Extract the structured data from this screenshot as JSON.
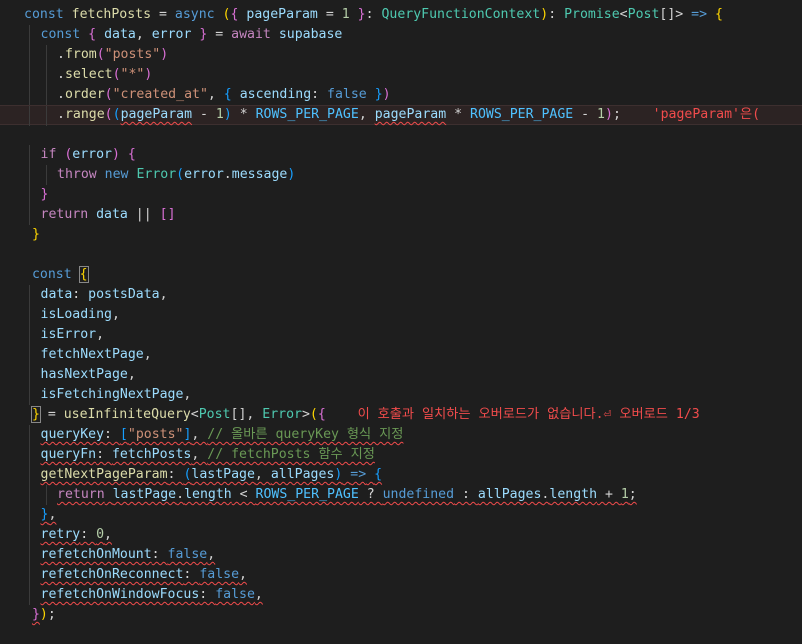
{
  "editor": {
    "lines": [
      {
        "indent": 0,
        "tokens": [
          [
            "kw",
            "const"
          ],
          [
            "op",
            " "
          ],
          [
            "fn",
            "fetchPosts"
          ],
          [
            "op",
            " = "
          ],
          [
            "kw",
            "async"
          ],
          [
            "op",
            " "
          ],
          [
            "br1",
            "("
          ],
          [
            "br2",
            "{"
          ],
          [
            "op",
            " "
          ],
          [
            "var",
            "pageParam"
          ],
          [
            "op",
            " = "
          ],
          [
            "num",
            "1"
          ],
          [
            "op",
            " "
          ],
          [
            "br2",
            "}"
          ],
          [
            "op",
            ": "
          ],
          [
            "type",
            "QueryFunctionContext"
          ],
          [
            "br1",
            ")"
          ],
          [
            "op",
            ": "
          ],
          [
            "type",
            "Promise"
          ],
          [
            "op",
            "<"
          ],
          [
            "type",
            "Post"
          ],
          [
            "op",
            "[]> "
          ],
          [
            "kw",
            "=>"
          ],
          [
            "op",
            " "
          ],
          [
            "br1",
            "{"
          ]
        ]
      },
      {
        "indent": 1,
        "tokens": [
          [
            "kw",
            "const"
          ],
          [
            "op",
            " "
          ],
          [
            "br2",
            "{"
          ],
          [
            "op",
            " "
          ],
          [
            "var",
            "data"
          ],
          [
            "op",
            ", "
          ],
          [
            "var",
            "error"
          ],
          [
            "op",
            " "
          ],
          [
            "br2",
            "}"
          ],
          [
            "op",
            " = "
          ],
          [
            "ctrl",
            "await"
          ],
          [
            "op",
            " "
          ],
          [
            "var",
            "supabase"
          ]
        ]
      },
      {
        "indent": 2,
        "tokens": [
          [
            "op",
            "."
          ],
          [
            "fn",
            "from"
          ],
          [
            "br2",
            "("
          ],
          [
            "str",
            "\"posts\""
          ],
          [
            "br2",
            ")"
          ]
        ]
      },
      {
        "indent": 2,
        "tokens": [
          [
            "op",
            "."
          ],
          [
            "fn",
            "select"
          ],
          [
            "br2",
            "("
          ],
          [
            "str",
            "\"*\""
          ],
          [
            "br2",
            ")"
          ]
        ]
      },
      {
        "indent": 2,
        "tokens": [
          [
            "op",
            "."
          ],
          [
            "fn",
            "order"
          ],
          [
            "br2",
            "("
          ],
          [
            "str",
            "\"created_at\""
          ],
          [
            "op",
            ", "
          ],
          [
            "br3",
            "{"
          ],
          [
            "op",
            " "
          ],
          [
            "var",
            "ascending"
          ],
          [
            "op",
            ": "
          ],
          [
            "kw",
            "false"
          ],
          [
            "op",
            " "
          ],
          [
            "br3",
            "}"
          ],
          [
            "br2",
            ")"
          ]
        ]
      },
      {
        "indent": 2,
        "hl": true,
        "tokens": [
          [
            "op",
            "."
          ],
          [
            "fn",
            "range"
          ],
          [
            "br2",
            "("
          ],
          [
            "br3",
            "("
          ],
          [
            "wvar",
            "pageParam"
          ],
          [
            "op",
            " - "
          ],
          [
            "num",
            "1"
          ],
          [
            "br3",
            ")"
          ],
          [
            "op",
            " * "
          ],
          [
            "const",
            "ROWS_PER_PAGE"
          ],
          [
            "op",
            ", "
          ],
          [
            "wvar",
            "pageParam"
          ],
          [
            "op",
            " * "
          ],
          [
            "const",
            "ROWS_PER_PAGE"
          ],
          [
            "op",
            " - "
          ],
          [
            "num",
            "1"
          ],
          [
            "br2",
            ")"
          ],
          [
            "op",
            ";"
          ],
          [
            "err",
            "    'pageParam'은("
          ]
        ]
      },
      {
        "indent": 0,
        "tokens": []
      },
      {
        "indent": 1,
        "tokens": [
          [
            "ctrl",
            "if"
          ],
          [
            "op",
            " "
          ],
          [
            "br2",
            "("
          ],
          [
            "var",
            "error"
          ],
          [
            "br2",
            ")"
          ],
          [
            "op",
            " "
          ],
          [
            "br2",
            "{"
          ]
        ]
      },
      {
        "indent": 2,
        "tokens": [
          [
            "ctrl",
            "throw"
          ],
          [
            "op",
            " "
          ],
          [
            "kw",
            "new"
          ],
          [
            "op",
            " "
          ],
          [
            "type",
            "Error"
          ],
          [
            "br3",
            "("
          ],
          [
            "var",
            "error"
          ],
          [
            "op",
            "."
          ],
          [
            "var",
            "message"
          ],
          [
            "br3",
            ")"
          ]
        ]
      },
      {
        "indent": 1,
        "tokens": [
          [
            "br2",
            "}"
          ]
        ]
      },
      {
        "indent": 1,
        "tokens": [
          [
            "ctrl",
            "return"
          ],
          [
            "op",
            " "
          ],
          [
            "var",
            "data"
          ],
          [
            "op",
            " || "
          ],
          [
            "br2",
            "[]"
          ]
        ]
      },
      {
        "indent": 0,
        "tokens": [
          [
            "op",
            " "
          ],
          [
            "br1",
            "}"
          ]
        ]
      },
      {
        "indent": 0,
        "tokens": []
      },
      {
        "indent": 0,
        "tokens": [
          [
            "op",
            " "
          ],
          [
            "kw",
            "const"
          ],
          [
            "op",
            " "
          ],
          [
            "curbr",
            "{"
          ]
        ]
      },
      {
        "indent": 1,
        "tokens": [
          [
            "var",
            "data"
          ],
          [
            "op",
            ": "
          ],
          [
            "var",
            "postsData"
          ],
          [
            "op",
            ","
          ]
        ]
      },
      {
        "indent": 1,
        "tokens": [
          [
            "var",
            "isLoading"
          ],
          [
            "op",
            ","
          ]
        ]
      },
      {
        "indent": 1,
        "tokens": [
          [
            "var",
            "isError"
          ],
          [
            "op",
            ","
          ]
        ]
      },
      {
        "indent": 1,
        "tokens": [
          [
            "var",
            "fetchNextPage"
          ],
          [
            "op",
            ","
          ]
        ]
      },
      {
        "indent": 1,
        "tokens": [
          [
            "var",
            "hasNextPage"
          ],
          [
            "op",
            ","
          ]
        ]
      },
      {
        "indent": 1,
        "tokens": [
          [
            "var",
            "isFetchingNextPage"
          ],
          [
            "op",
            ","
          ]
        ]
      },
      {
        "indent": 0,
        "tokens": [
          [
            "op",
            " "
          ],
          [
            "curbr",
            "}"
          ],
          [
            "op",
            " = "
          ],
          [
            "fn",
            "useInfiniteQuery"
          ],
          [
            "op",
            "<"
          ],
          [
            "type",
            "Post"
          ],
          [
            "op",
            "[], "
          ],
          [
            "type",
            "Error"
          ],
          [
            "op",
            ">"
          ],
          [
            "br1",
            "("
          ],
          [
            "br2",
            "{"
          ],
          [
            "err",
            "    이 호출과 일치하는 오버로드가 없습니다.⏎ 오버로드 1/3"
          ]
        ]
      },
      {
        "indent": 1,
        "tokens": [
          [
            "wvar",
            "queryKey"
          ],
          [
            "wop",
            ": "
          ],
          [
            "wbr3",
            "["
          ],
          [
            "wstr",
            "\"posts\""
          ],
          [
            "wbr3",
            "]"
          ],
          [
            "wop",
            ", "
          ],
          [
            "wcmt",
            "// 올바른 queryKey 형식 지정"
          ]
        ]
      },
      {
        "indent": 1,
        "tokens": [
          [
            "wvar",
            "queryFn"
          ],
          [
            "wop",
            ": "
          ],
          [
            "wvar",
            "fetchPosts"
          ],
          [
            "wop",
            ", "
          ],
          [
            "wcmt",
            "// fetchPosts 함수 지정"
          ]
        ]
      },
      {
        "indent": 1,
        "tokens": [
          [
            "wfn",
            "getNextPageParam"
          ],
          [
            "wop",
            ": "
          ],
          [
            "wbr3",
            "("
          ],
          [
            "wvar",
            "lastPage"
          ],
          [
            "wop",
            ", "
          ],
          [
            "wvar",
            "allPages"
          ],
          [
            "wbr3",
            ")"
          ],
          [
            "wop",
            " "
          ],
          [
            "wkw",
            "=>"
          ],
          [
            "wop",
            " "
          ],
          [
            "wbr3",
            "{"
          ]
        ]
      },
      {
        "indent": 2,
        "tokens": [
          [
            "wctrl",
            "return"
          ],
          [
            "wop",
            " "
          ],
          [
            "wvar",
            "lastPage"
          ],
          [
            "wop",
            "."
          ],
          [
            "wvar",
            "length"
          ],
          [
            "wop",
            " < "
          ],
          [
            "wconst",
            "ROWS_PER_PAGE"
          ],
          [
            "wop",
            " ? "
          ],
          [
            "wkw",
            "undefined"
          ],
          [
            "wop",
            " : "
          ],
          [
            "wvar",
            "allPages"
          ],
          [
            "wop",
            "."
          ],
          [
            "wvar",
            "length"
          ],
          [
            "wop",
            " + "
          ],
          [
            "wnum",
            "1"
          ],
          [
            "wop",
            ";"
          ]
        ]
      },
      {
        "indent": 1,
        "tokens": [
          [
            "wbr3",
            "}"
          ],
          [
            "wop",
            ","
          ]
        ]
      },
      {
        "indent": 1,
        "tokens": [
          [
            "wvar",
            "retry"
          ],
          [
            "wop",
            ": "
          ],
          [
            "wnum",
            "0"
          ],
          [
            "wop",
            ","
          ]
        ]
      },
      {
        "indent": 1,
        "tokens": [
          [
            "wvar",
            "refetchOnMount"
          ],
          [
            "wop",
            ": "
          ],
          [
            "wkw",
            "false"
          ],
          [
            "wop",
            ","
          ]
        ]
      },
      {
        "indent": 1,
        "tokens": [
          [
            "wvar",
            "refetchOnReconnect"
          ],
          [
            "wop",
            ": "
          ],
          [
            "wkw",
            "false"
          ],
          [
            "wop",
            ","
          ]
        ]
      },
      {
        "indent": 1,
        "tokens": [
          [
            "wvar",
            "refetchOnWindowFocus"
          ],
          [
            "wop",
            ": "
          ],
          [
            "wkw",
            "false"
          ],
          [
            "wop",
            ","
          ]
        ]
      },
      {
        "indent": 0,
        "tokens": [
          [
            "op",
            " "
          ],
          [
            "wbr2",
            "}"
          ],
          [
            "br1",
            ")"
          ],
          [
            "op",
            ";"
          ]
        ]
      }
    ]
  }
}
